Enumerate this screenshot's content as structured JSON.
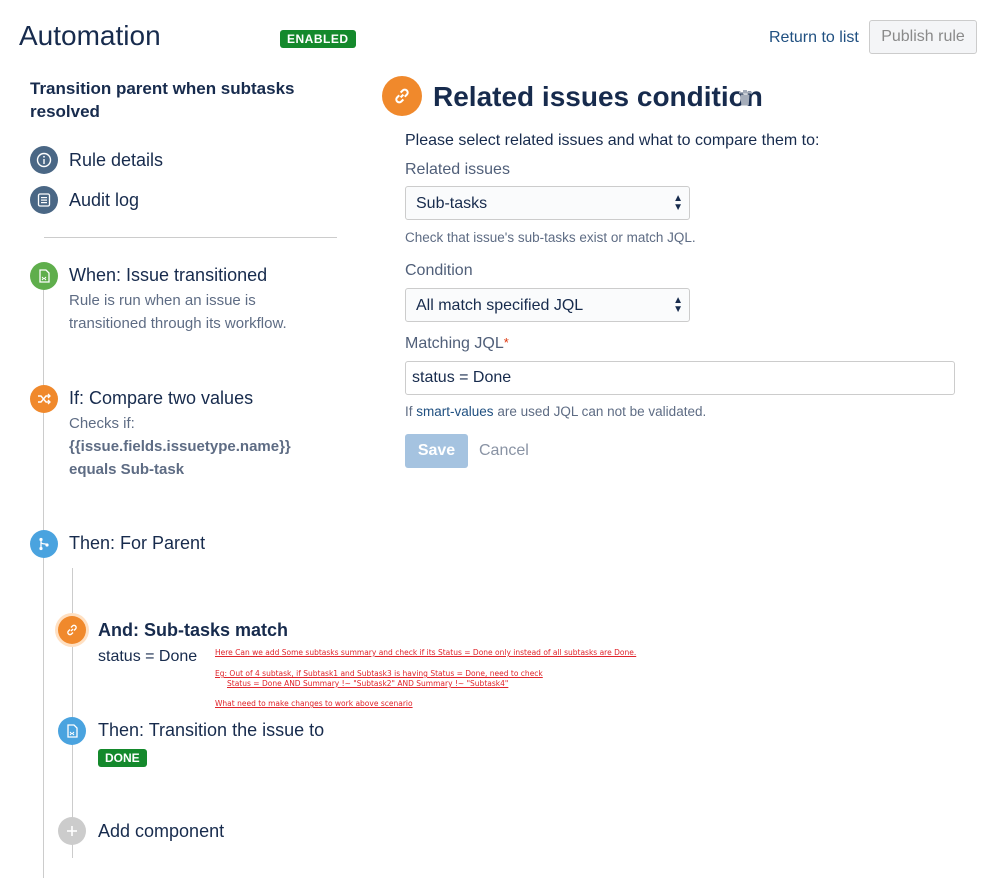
{
  "header": {
    "title": "Automation",
    "status_badge": "ENABLED",
    "return_link": "Return to list",
    "publish_button": "Publish rule"
  },
  "sidebar": {
    "rule_name": "Transition parent when subtasks resolved",
    "nav": [
      {
        "label": "Rule details",
        "icon": "info-icon"
      },
      {
        "label": "Audit log",
        "icon": "list-icon"
      }
    ],
    "steps": {
      "trigger": {
        "title": "When: Issue transitioned",
        "description": "Rule is run when an issue is transitioned through its workflow."
      },
      "condition": {
        "title": "If: Compare two values",
        "desc_prefix": "Checks if:",
        "desc_value": "{{issue.fields.issuetype.name}}",
        "desc_suffix": "equals Sub-task"
      },
      "branch": {
        "title": "Then: For Parent"
      },
      "sub_condition": {
        "title": "And: Sub-tasks match",
        "description": "status = Done"
      },
      "action": {
        "title": "Then: Transition the issue to",
        "badge": "DONE"
      },
      "add": {
        "title": "Add component"
      }
    },
    "annotations": [
      "Here Can we add Some subtasks summary and check if its Status = Done only instead of all subtasks are Done.",
      "Eg: Out of 4 subtask, if Subtask1 and Subtask3 is having Status = Done, need to check",
      "Status = Done AND Summary !~ \"Subtask2\" AND Summary !~ \"Subtask4\"",
      "What need to make changes to work above scenario"
    ]
  },
  "panel": {
    "title": "Related issues condition",
    "intro": "Please select related issues and what to compare them to:",
    "related_label": "Related issues",
    "related_value": "Sub-tasks",
    "related_help": "Check that issue's sub-tasks exist or match JQL.",
    "condition_label": "Condition",
    "condition_value": "All match specified JQL",
    "jql_label": "Matching JQL",
    "jql_required": "*",
    "jql_value": "status = Done",
    "jql_help_prefix": "If",
    "jql_help_link": "smart-values",
    "jql_help_suffix": "are used JQL can not be validated.",
    "save": "Save",
    "cancel": "Cancel"
  },
  "colors": {
    "enabled_green": "#14892c",
    "link_blue": "#205081",
    "orange": "#f0892c",
    "step_blue": "#4aa3df",
    "step_green": "#5fae4c",
    "nav_dark": "#4a6785"
  }
}
